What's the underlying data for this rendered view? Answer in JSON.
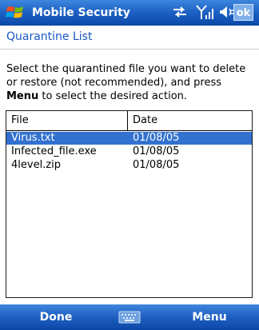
{
  "titlebar": {
    "title": "Mobile Security",
    "ok_label": "ok"
  },
  "page": {
    "heading": "Quarantine List"
  },
  "instructions": {
    "line_before": "Select the quarantined file you want to delete or restore (not recommended), and press ",
    "menu_word": "Menu",
    "line_after": " to select the desired action."
  },
  "list": {
    "columns": [
      "File",
      "Date"
    ],
    "rows": [
      {
        "file": "Virus.txt",
        "date": "01/08/05",
        "selected": true
      },
      {
        "file": "Infected_file.exe",
        "date": "01/08/05",
        "selected": false
      },
      {
        "file": "4level.zip",
        "date": "01/08/05",
        "selected": false
      }
    ]
  },
  "menubar": {
    "left_label": "Done",
    "right_label": "Menu"
  },
  "icons": [
    "windows-start-icon",
    "connectivity-icon",
    "signal-strength-icon",
    "speaker-icon",
    "keyboard-icon"
  ],
  "colors": {
    "accent_blue": "#1f63c6",
    "heading_blue": "#1a57c2",
    "selection": "#3271cf"
  }
}
